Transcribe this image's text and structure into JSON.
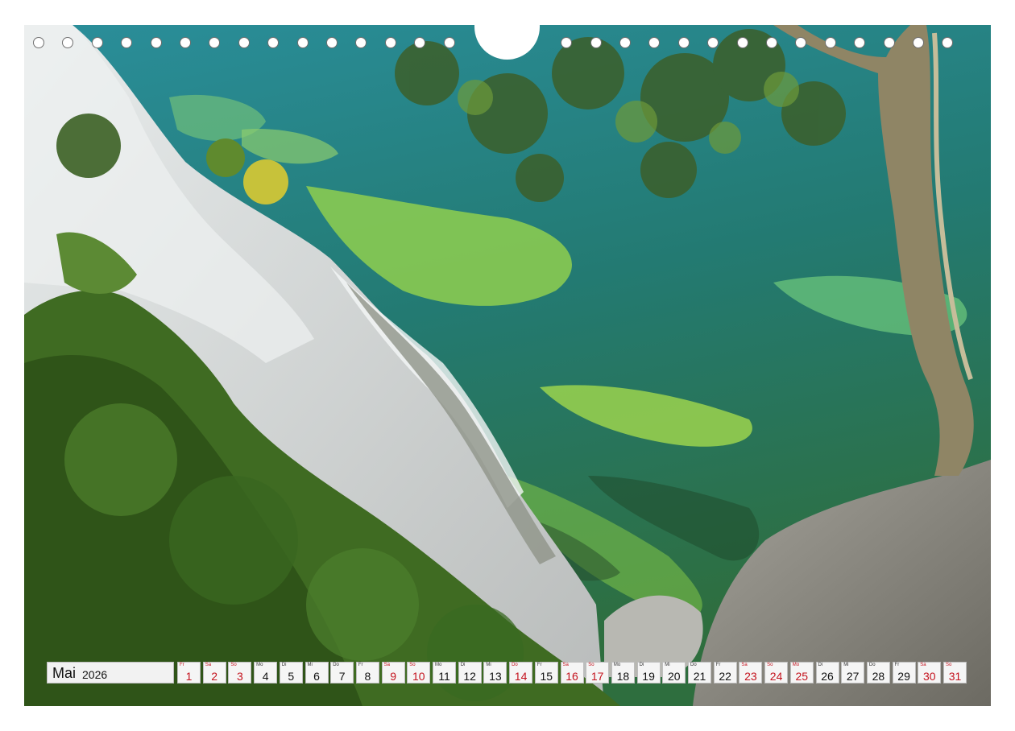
{
  "calendar": {
    "month": "Mai",
    "year": "2026",
    "days": [
      {
        "wd": "Fr",
        "d": "1",
        "red": true
      },
      {
        "wd": "Sa",
        "d": "2",
        "red": true
      },
      {
        "wd": "So",
        "d": "3",
        "red": true
      },
      {
        "wd": "Mo",
        "d": "4",
        "red": false
      },
      {
        "wd": "Di",
        "d": "5",
        "red": false
      },
      {
        "wd": "Mi",
        "d": "6",
        "red": false
      },
      {
        "wd": "Do",
        "d": "7",
        "red": false
      },
      {
        "wd": "Fr",
        "d": "8",
        "red": false
      },
      {
        "wd": "Sa",
        "d": "9",
        "red": true
      },
      {
        "wd": "So",
        "d": "10",
        "red": true
      },
      {
        "wd": "Mo",
        "d": "11",
        "red": false
      },
      {
        "wd": "Di",
        "d": "12",
        "red": false
      },
      {
        "wd": "Mi",
        "d": "13",
        "red": false
      },
      {
        "wd": "Do",
        "d": "14",
        "red": true
      },
      {
        "wd": "Fr",
        "d": "15",
        "red": false
      },
      {
        "wd": "Sa",
        "d": "16",
        "red": true
      },
      {
        "wd": "So",
        "d": "17",
        "red": true
      },
      {
        "wd": "Mo",
        "d": "18",
        "red": false
      },
      {
        "wd": "Di",
        "d": "19",
        "red": false
      },
      {
        "wd": "Mi",
        "d": "20",
        "red": false
      },
      {
        "wd": "Do",
        "d": "21",
        "red": false
      },
      {
        "wd": "Fr",
        "d": "22",
        "red": false
      },
      {
        "wd": "Sa",
        "d": "23",
        "red": true
      },
      {
        "wd": "So",
        "d": "24",
        "red": true
      },
      {
        "wd": "Mo",
        "d": "25",
        "red": true
      },
      {
        "wd": "Di",
        "d": "26",
        "red": false
      },
      {
        "wd": "Mi",
        "d": "27",
        "red": false
      },
      {
        "wd": "Do",
        "d": "28",
        "red": false
      },
      {
        "wd": "Fr",
        "d": "29",
        "red": false
      },
      {
        "wd": "Sa",
        "d": "30",
        "red": true
      },
      {
        "wd": "So",
        "d": "31",
        "red": true
      }
    ]
  },
  "colors": {
    "holiday_red": "#c4121d",
    "sea_deep": "#1f7f86",
    "sea_shallow": "#7ccb4a",
    "chalk": "#d9dcdc",
    "forest": "#3f6b22"
  },
  "binding_holes": 32
}
